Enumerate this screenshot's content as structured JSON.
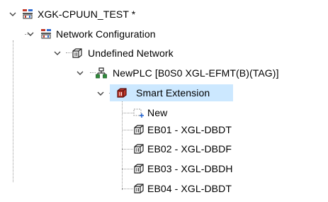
{
  "tree": {
    "root": {
      "label": "XGK-CPUUN_TEST *",
      "icon": "network-project-icon",
      "expanded": true
    },
    "network_configuration": {
      "label": "Network Configuration",
      "icon": "network-project-icon",
      "expanded": true
    },
    "undefined_network": {
      "label": "Undefined Network",
      "icon": "module-block-icon",
      "expanded": true
    },
    "plc": {
      "label": "NewPLC [B0S0 XGL-EFMT(B)(TAG)]",
      "icon": "plc-network-node-icon",
      "expanded": true
    },
    "smart_extension": {
      "label": "Smart Extension",
      "icon": "module-block-icon",
      "expanded": true,
      "selected": true
    },
    "children": [
      {
        "label": "New",
        "icon": "new-item-icon"
      },
      {
        "label": "EB01 - XGL-DBDT",
        "icon": "module-block-icon"
      },
      {
        "label": "EB02 - XGL-DBDF",
        "icon": "module-block-icon"
      },
      {
        "label": "EB03 - XGL-DBDH",
        "icon": "module-block-icon"
      },
      {
        "label": "EB04 - XGL-DBDT",
        "icon": "module-block-icon"
      }
    ]
  },
  "colors": {
    "selection": "#cce8ff",
    "guide": "#9a9a9a",
    "icon_red": "#c0392b",
    "icon_blue": "#2f6bd1"
  }
}
